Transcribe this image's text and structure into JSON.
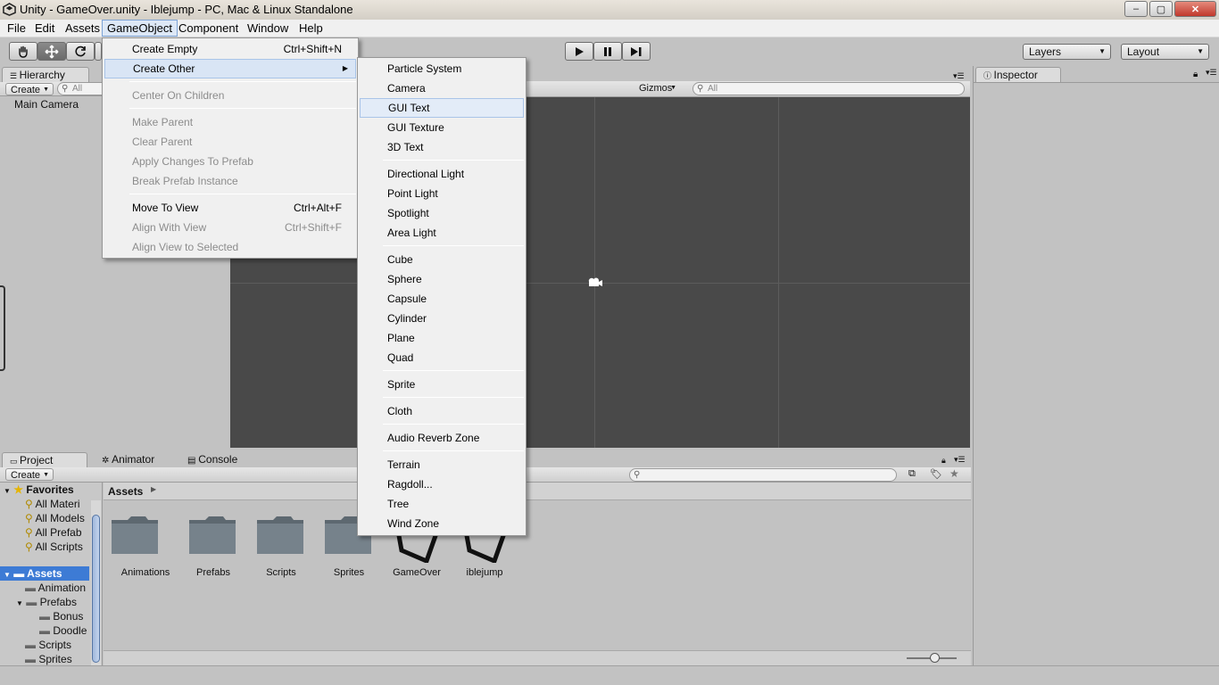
{
  "window": {
    "title": "Unity - GameOver.unity - Iblejump - PC, Mac & Linux Standalone",
    "minimize": "–",
    "maximize": "▢",
    "close": "✕"
  },
  "menubar": [
    "File",
    "Edit",
    "Assets",
    "GameObject",
    "Component",
    "Window",
    "Help"
  ],
  "toolbar": {
    "tools": [
      "hand-icon",
      "move-icon",
      "rotate-icon"
    ],
    "layers": "Layers",
    "layout": "Layout"
  },
  "hierarchy": {
    "tab": "Hierarchy",
    "create": "Create",
    "search_placeholder": "All",
    "items": [
      "Main Camera"
    ]
  },
  "scene": {
    "gizmos": "Gizmos",
    "search_placeholder": "All"
  },
  "inspector": {
    "tab": "Inspector"
  },
  "bottom_tabs": [
    "Project",
    "Animator",
    "Console"
  ],
  "project": {
    "create": "Create",
    "favorites_label": "Favorites",
    "favorites": [
      "All Materi",
      "All Models",
      "All Prefab",
      "All Scripts"
    ],
    "assets_label": "Assets",
    "asset_tree": [
      {
        "label": "Animation",
        "indent": 1
      },
      {
        "label": "Prefabs",
        "indent": 1
      },
      {
        "label": "Bonus",
        "indent": 2
      },
      {
        "label": "Doodle",
        "indent": 2
      },
      {
        "label": "Scripts",
        "indent": 1
      },
      {
        "label": "Sprites",
        "indent": 1
      }
    ],
    "breadcrumb": "Assets",
    "assets": [
      {
        "label": "Animations",
        "type": "folder"
      },
      {
        "label": "Prefabs",
        "type": "folder"
      },
      {
        "label": "Scripts",
        "type": "folder"
      },
      {
        "label": "Sprites",
        "type": "folder"
      },
      {
        "label": "GameOver",
        "type": "unity-scene"
      },
      {
        "label": "iblejump",
        "type": "unity-scene"
      }
    ]
  },
  "gameobject_menu": {
    "items": [
      {
        "label": "Create Empty",
        "shortcut": "Ctrl+Shift+N",
        "disabled": false
      },
      {
        "label": "Create Other",
        "shortcut": "",
        "disabled": false,
        "submenu": true
      },
      {
        "sep": true
      },
      {
        "label": "Center On Children",
        "shortcut": "",
        "disabled": true
      },
      {
        "sep": true
      },
      {
        "label": "Make Parent",
        "shortcut": "",
        "disabled": true
      },
      {
        "label": "Clear Parent",
        "shortcut": "",
        "disabled": true
      },
      {
        "label": "Apply Changes To Prefab",
        "shortcut": "",
        "disabled": true
      },
      {
        "label": "Break Prefab Instance",
        "shortcut": "",
        "disabled": true
      },
      {
        "sep": true
      },
      {
        "label": "Move To View",
        "shortcut": "Ctrl+Alt+F",
        "disabled": false
      },
      {
        "label": "Align With View",
        "shortcut": "Ctrl+Shift+F",
        "disabled": true
      },
      {
        "label": "Align View to Selected",
        "shortcut": "",
        "disabled": true
      }
    ]
  },
  "create_other_menu": {
    "highlighted": "GUI Text",
    "groups": [
      [
        "Particle System",
        "Camera",
        "GUI Text",
        "GUI Texture",
        "3D Text"
      ],
      [
        "Directional Light",
        "Point Light",
        "Spotlight",
        "Area Light"
      ],
      [
        "Cube",
        "Sphere",
        "Capsule",
        "Cylinder",
        "Plane",
        "Quad"
      ],
      [
        "Sprite"
      ],
      [
        "Cloth"
      ],
      [
        "Audio Reverb Zone"
      ],
      [
        "Terrain",
        "Ragdoll...",
        "Tree",
        "Wind Zone"
      ]
    ]
  },
  "colors": {
    "editor_bg": "#c2c2c2",
    "scene_bg": "#494949",
    "selection_blue": "#3d7bd5",
    "menu_bg": "#f0f0f0",
    "highlight": "#e3ecf8"
  }
}
